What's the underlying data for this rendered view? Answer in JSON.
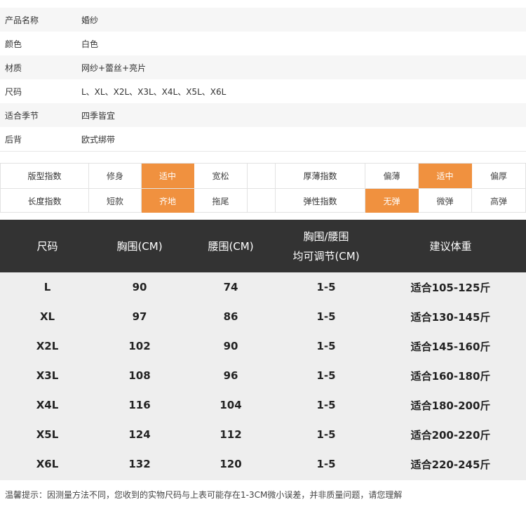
{
  "product_info": [
    {
      "key": "产品名称",
      "value": "婚纱"
    },
    {
      "key": "颜色",
      "value": "白色"
    },
    {
      "key": "材质",
      "value": "网纱+蕾丝+亮片"
    },
    {
      "key": "尺码",
      "value": "L、XL、X2L、X3L、X4L、X5L、X6L"
    },
    {
      "key": "适合季节",
      "value": "四季皆宜"
    },
    {
      "key": "后背",
      "value": "欧式绑带"
    }
  ],
  "indices": {
    "row1": {
      "label_a": "版型指数",
      "a": [
        "修身",
        "适中",
        "宽松"
      ],
      "label_b": "厚薄指数",
      "b": [
        "偏薄",
        "适中",
        "偏厚"
      ]
    },
    "row2": {
      "label_a": "长度指数",
      "a": [
        "短款",
        "齐地",
        "拖尾"
      ],
      "label_b": "弹性指数",
      "b": [
        "无弹",
        "微弹",
        "高弹"
      ]
    },
    "highlight_color": "#f0913f"
  },
  "size_table": {
    "headers": {
      "size": "尺码",
      "bust": "胸围(CM)",
      "waist": "腰围(CM)",
      "adjust_line1": "胸围/腰围",
      "adjust_line2": "均可调节(CM)",
      "weight": "建议体重"
    },
    "rows": [
      {
        "size": "L",
        "bust": "90",
        "waist": "74",
        "adjust": "1-5",
        "weight": "适合105-125斤"
      },
      {
        "size": "XL",
        "bust": "97",
        "waist": "86",
        "adjust": "1-5",
        "weight": "适合130-145斤"
      },
      {
        "size": "X2L",
        "bust": "102",
        "waist": "90",
        "adjust": "1-5",
        "weight": "适合145-160斤"
      },
      {
        "size": "X3L",
        "bust": "108",
        "waist": "96",
        "adjust": "1-5",
        "weight": "适合160-180斤"
      },
      {
        "size": "X4L",
        "bust": "116",
        "waist": "104",
        "adjust": "1-5",
        "weight": "适合180-200斤"
      },
      {
        "size": "X5L",
        "bust": "124",
        "waist": "112",
        "adjust": "1-5",
        "weight": "适合200-220斤"
      },
      {
        "size": "X6L",
        "bust": "132",
        "waist": "120",
        "adjust": "1-5",
        "weight": "适合220-245斤"
      }
    ]
  },
  "note": "温馨提示：因测量方法不同，您收到的实物尺码与上表可能存在1-3CM微小误差，并非质量问题，请您理解"
}
